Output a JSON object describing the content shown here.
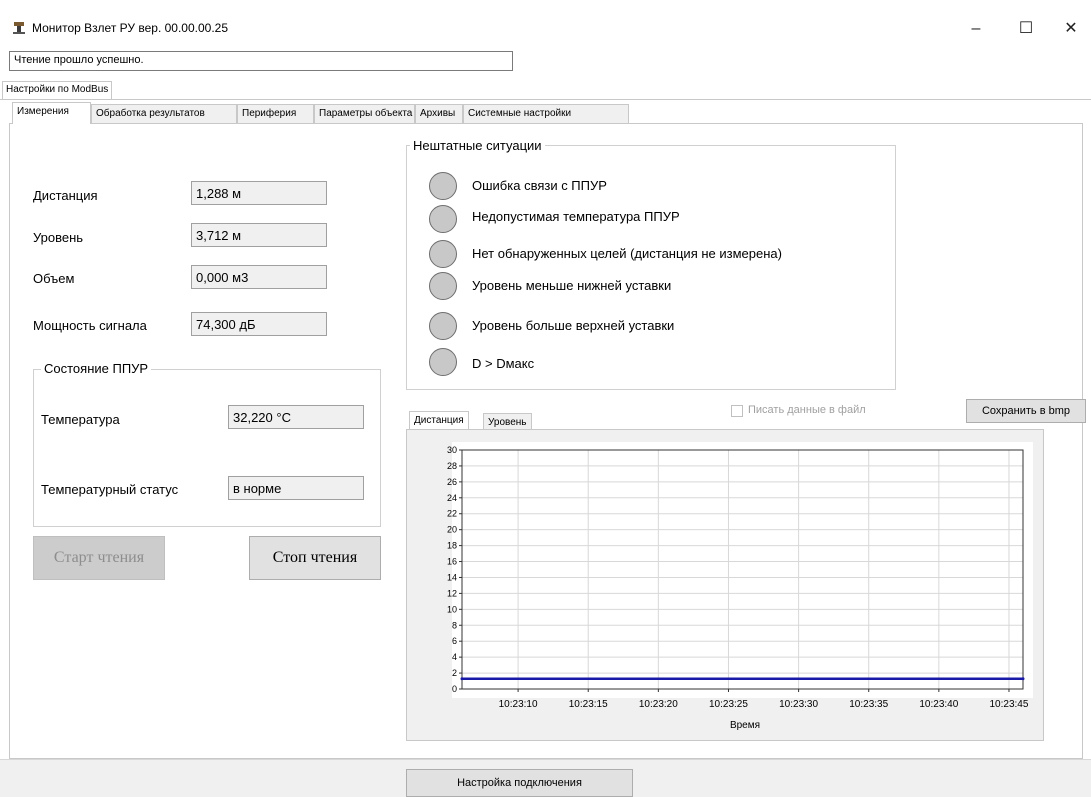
{
  "window": {
    "title": "Монитор Взлет РУ вер. 00.00.00.25",
    "minimize": "–",
    "maximize": "☐",
    "close": "✕"
  },
  "status_message": "Чтение прошло успешно.",
  "outer_tab": "Настройки по ModBus",
  "tabs": [
    "Измерения",
    "Обработка результатов",
    "Периферия",
    "Параметры объекта",
    "Архивы",
    "Системные настройки"
  ],
  "measurements": [
    {
      "label": "Дистанция",
      "value": "1,288 м"
    },
    {
      "label": "Уровень",
      "value": "3,712 м"
    },
    {
      "label": "Объем",
      "value": "0,000 м3"
    },
    {
      "label": "Мощность сигнала",
      "value": "74,300 дБ"
    }
  ],
  "sensor_state": {
    "title": "Состояние ППУР",
    "temperature_label": "Температура",
    "temperature_value": "32,220 °C",
    "temp_status_label": "Температурный статус",
    "temp_status_value": "в норме"
  },
  "buttons": {
    "start": "Старт чтения",
    "stop": "Стоп чтения",
    "save_bmp": "Сохранить в bmp",
    "connection": "Настройка подключения"
  },
  "alarms": {
    "title": "Нештатные ситуации",
    "items": [
      "Ошибка связи с ППУР",
      "Недопустимая температура ППУР",
      "Нет обнаруженных целей (дистанция не измерена)",
      "Уровень меньше нижней уставки",
      "Уровень больше верхней уставки",
      "D > Dмакс"
    ]
  },
  "chart_tabs": [
    "Дистанция",
    "Уровень"
  ],
  "write_to_file_label": "Писать данные в файл",
  "colors": {
    "series": "#1a1aa8",
    "led": "#c8c8c8"
  },
  "chart_data": {
    "type": "line",
    "xlabel": "Время",
    "ylabel": "",
    "ylim": [
      0,
      30
    ],
    "yticks": [
      0,
      2,
      4,
      6,
      8,
      10,
      12,
      14,
      16,
      18,
      20,
      22,
      24,
      26,
      28,
      30
    ],
    "x_ticks": [
      "10:23:10",
      "10:23:15",
      "10:23:20",
      "10:23:25",
      "10:23:30",
      "10:23:35",
      "10:23:40",
      "10:23:45"
    ],
    "x": [
      "10:23:06",
      "10:23:46"
    ],
    "values": [
      1.29,
      1.29
    ],
    "grid": true
  }
}
